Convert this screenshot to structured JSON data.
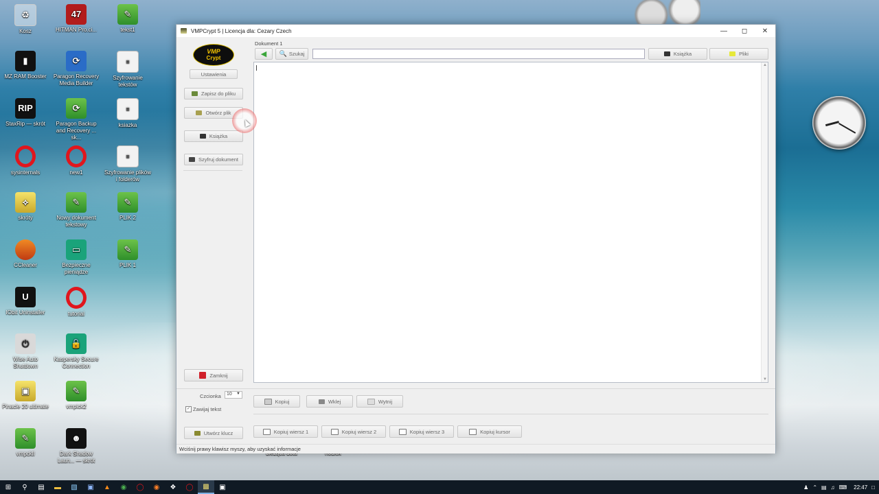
{
  "desktop": {
    "icons": [
      {
        "label": "Kosz",
        "icon": "recycle-bin-icon"
      },
      {
        "label": "HITMAN Pro.ci...",
        "icon": "hitman-icon"
      },
      {
        "label": "tekst1",
        "icon": "text-document-icon"
      },
      {
        "label": "MZ RAM Booster",
        "icon": "ram-booster-icon"
      },
      {
        "label": "Paragon Recovery Media Builder",
        "icon": "paragon-icon"
      },
      {
        "label": "Szyfrowanie tekstów",
        "icon": "document-icon"
      },
      {
        "label": "StaxRip — skrót",
        "icon": "staxrip-icon"
      },
      {
        "label": "Paragon Backup and Recovery ... sk...",
        "icon": "paragon-backup-icon"
      },
      {
        "label": "ksiazka",
        "icon": "document-icon"
      },
      {
        "label": "sysinternals",
        "icon": "opera-icon"
      },
      {
        "label": "new1",
        "icon": "opera-icon"
      },
      {
        "label": "Szyfrowanie plików i folderów",
        "icon": "document-icon"
      },
      {
        "label": "skróty",
        "icon": "shortcut-folder-icon"
      },
      {
        "label": "Nowy dokument tekstowy",
        "icon": "text-document-icon"
      },
      {
        "label": "PLIK 2",
        "icon": "text-document-icon"
      },
      {
        "label": "CCleaner",
        "icon": "ccleaner-icon"
      },
      {
        "label": "Bezpieczne pieniądze",
        "icon": "safe-money-icon"
      },
      {
        "label": "PLIK 1",
        "icon": "text-document-icon"
      },
      {
        "label": "IObit Uninstaller",
        "icon": "iobit-icon"
      },
      {
        "label": "tutorial",
        "icon": "opera-icon"
      },
      {
        "label": "Wise Auto Shutdown",
        "icon": "wise-shutdown-icon"
      },
      {
        "label": "Kaspersky Secure Connection",
        "icon": "kaspersky-icon"
      },
      {
        "label": "Pinacle 20 ultimate",
        "icon": "pinnacle-icon"
      },
      {
        "label": "vmpick2",
        "icon": "text-document-icon"
      },
      {
        "label": "vmpckll",
        "icon": "text-document-icon"
      },
      {
        "label": "Dark Shadow Laun... — skrót",
        "icon": "game-icon"
      }
    ],
    "behind_labels": [
      "bieżąca dota",
      "nodiok"
    ]
  },
  "window": {
    "title": "VMPCrypt 5 | Licencja dla: Cezary Czech",
    "logo_line1": "VMP",
    "logo_line2": "Crypt",
    "settings_label": "Ustawienia",
    "save_label": "Zapisz do pliku",
    "open_label": "Otwórz plik",
    "book_label": "Książka",
    "encrypt_label": "Szyfruj dokument",
    "close_label": "Zamknij",
    "doc_tab": "Dokument 1",
    "search_label": "Szukaj",
    "search_value": "",
    "book_top_label": "Książka",
    "files_label": "Pliki",
    "font_label": "Czcionka",
    "font_size": "10",
    "wrap_label": "Zawijaj tekst",
    "wrap_checked": "✓",
    "create_key_label": "Utwórz klucz",
    "copy_label": "Kopiuj",
    "paste_label": "Wklej",
    "cut_label": "Wytnij",
    "copy_row1": "Kopiuj wiersz 1",
    "copy_row2": "Kopiuj wiersz 2",
    "copy_row3": "Kopiuj wiersz 3",
    "copy_cursor": "Kopiuj kursor",
    "status_text": "Wciśnij prawy klawisz myszy, aby uzyskać informacje"
  },
  "taskbar": {
    "time": "22:47",
    "colors": {
      "bg": "#101a24"
    }
  }
}
